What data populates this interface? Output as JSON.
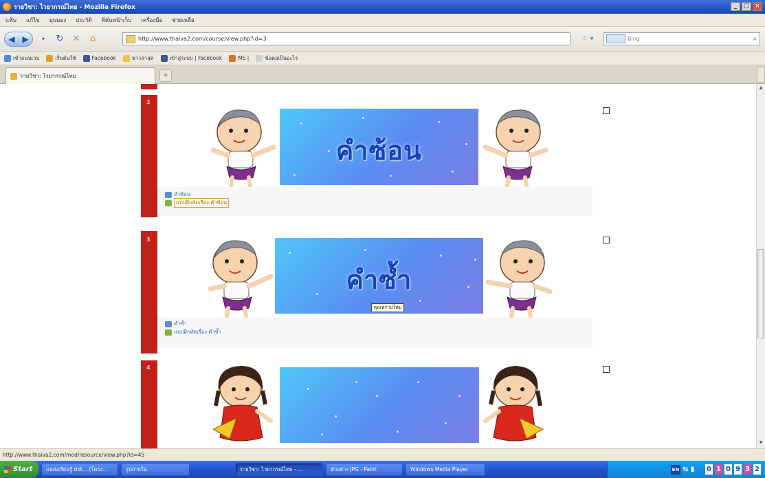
{
  "window": {
    "title": "รายวิชา: ไวยากรณ์ไทย - Mozilla Firefox",
    "controls": [
      "_",
      "□",
      "×"
    ]
  },
  "menu": [
    "แฟ้ม",
    "แก้ไข",
    "มุมมอง",
    "ประวัติ",
    "ที่คั่นหน้าเว็บ",
    "เครื่องมือ",
    "ช่วยเหลือ"
  ],
  "nav": {
    "url": "http://www.thaiva2.com/course/view.php?id=3",
    "search_placeholder": "Bing",
    "star": "☆ ▾"
  },
  "bookmarks": [
    "เข้าถนนเวบ",
    "เริ่มต้นใช้",
    "Facebook",
    "ข่าวล่าสุด",
    "เข้าสู่ระบบ | Facebook",
    "MS |",
    "ข้อคอเป็นอะไร"
  ],
  "tab": {
    "label": "รายวิชา: ไวยากรณ์ไทย"
  },
  "sections": [
    {
      "number": "2",
      "banner_title": "คำซ้อน",
      "links": [
        "คำซ้อน",
        "แบบฝึกหัดเรื่อง คำซ้อน"
      ]
    },
    {
      "number": "3",
      "banner_title": "คำซ้ำ",
      "links": [
        "คำซ้ำ",
        "แบบฝึกหัดเรื่อง คำซ้ำ"
      ]
    },
    {
      "number": "4",
      "banner_title": "",
      "links": []
    }
  ],
  "tooltip": "คุณทราบไหม",
  "status": "http://www.thaiva2.com/mod/resource/view.php?id=45",
  "taskbar": {
    "start": "Start",
    "items": [
      "แหล่งเรียนรู้ dot... (โครง...",
      "รูปถ่ายใน",
      "รายวิชา: ไวยากรณ์ไทย - ...",
      "ตัวอย่าง JPG - Paint",
      "Windows Media Player"
    ],
    "clock": [
      "0",
      "1",
      "0",
      "9",
      "3",
      "2"
    ]
  },
  "colors": {
    "section_bar": "#c2201b",
    "banner_text": "#1741b8",
    "titlebar": "#2455c4"
  }
}
